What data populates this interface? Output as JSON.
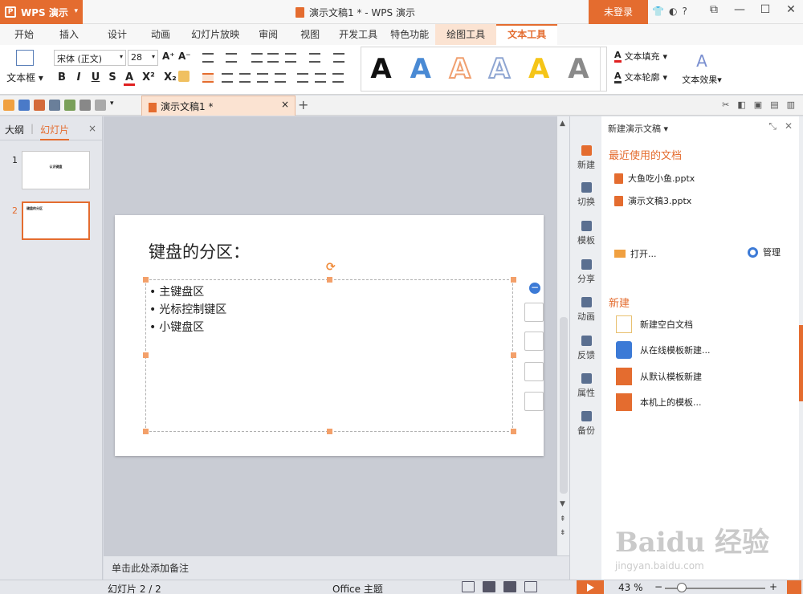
{
  "titlebar": {
    "app_name": "WPS 演示",
    "doc_title": "演示文稿1 * - WPS 演示",
    "login": "未登录",
    "help": "?"
  },
  "ribbon_tabs": [
    "开始",
    "插入",
    "设计",
    "动画",
    "幻灯片放映",
    "审阅",
    "视图",
    "开发工具",
    "特色功能",
    "绘图工具",
    "文本工具"
  ],
  "ribbon": {
    "textbox_label": "文本框",
    "font_name": "宋体 (正文)",
    "font_size": "28",
    "format_buttons": [
      "B",
      "I",
      "U",
      "S",
      "A",
      "X²",
      "X₂"
    ],
    "style_samples": [
      {
        "letter": "A",
        "color": "#111111"
      },
      {
        "letter": "A",
        "color": "#4a8ad4"
      },
      {
        "letter": "A",
        "color": "#f0a070"
      },
      {
        "letter": "A",
        "color": "#b8c6e0"
      },
      {
        "letter": "A",
        "color": "#f5c518"
      },
      {
        "letter": "A",
        "color": "#8a8a8a"
      }
    ],
    "text_fill": "文本填充",
    "text_outline": "文本轮廓",
    "text_effect": "文本效果",
    "effect_letter": "A"
  },
  "quick_access": {
    "doc_tab": "演示文稿1 *",
    "close": "×",
    "new_tab": "+"
  },
  "left_panel": {
    "tabs": [
      "大纲",
      "幻灯片"
    ],
    "close": "×",
    "thumbs": [
      {
        "num": "1",
        "text": "认识键盘"
      },
      {
        "num": "2",
        "text": "键盘的分区"
      }
    ]
  },
  "slide": {
    "title": "键盘的分区：",
    "bullets": [
      "主键盘区",
      "光标控制键区",
      "小键盘区"
    ]
  },
  "notes_placeholder": "单击此处添加备注",
  "side_icons": [
    "新建",
    "切换",
    "模板",
    "分享",
    "动画",
    "反馈",
    "属性",
    "备份"
  ],
  "right_panel": {
    "header": "新建演示文稿",
    "recent_title": "最近使用的文档",
    "recent_files": [
      "大鱼吃小鱼.pptx",
      "演示文稿3.pptx"
    ],
    "open": "打开...",
    "manage": "管理",
    "new_title": "新建",
    "new_items": [
      "新建空白文档",
      "从在线模板新建...",
      "从默认模板新建",
      "本机上的模板..."
    ]
  },
  "status": {
    "slide_info": "幻灯片 2 / 2",
    "theme": "Office 主题",
    "zoom": "43 %",
    "zoom_minus": "−",
    "zoom_plus": "+"
  },
  "watermark": {
    "brand": "Baidu 经验",
    "url": "jingyan.baidu.com"
  }
}
